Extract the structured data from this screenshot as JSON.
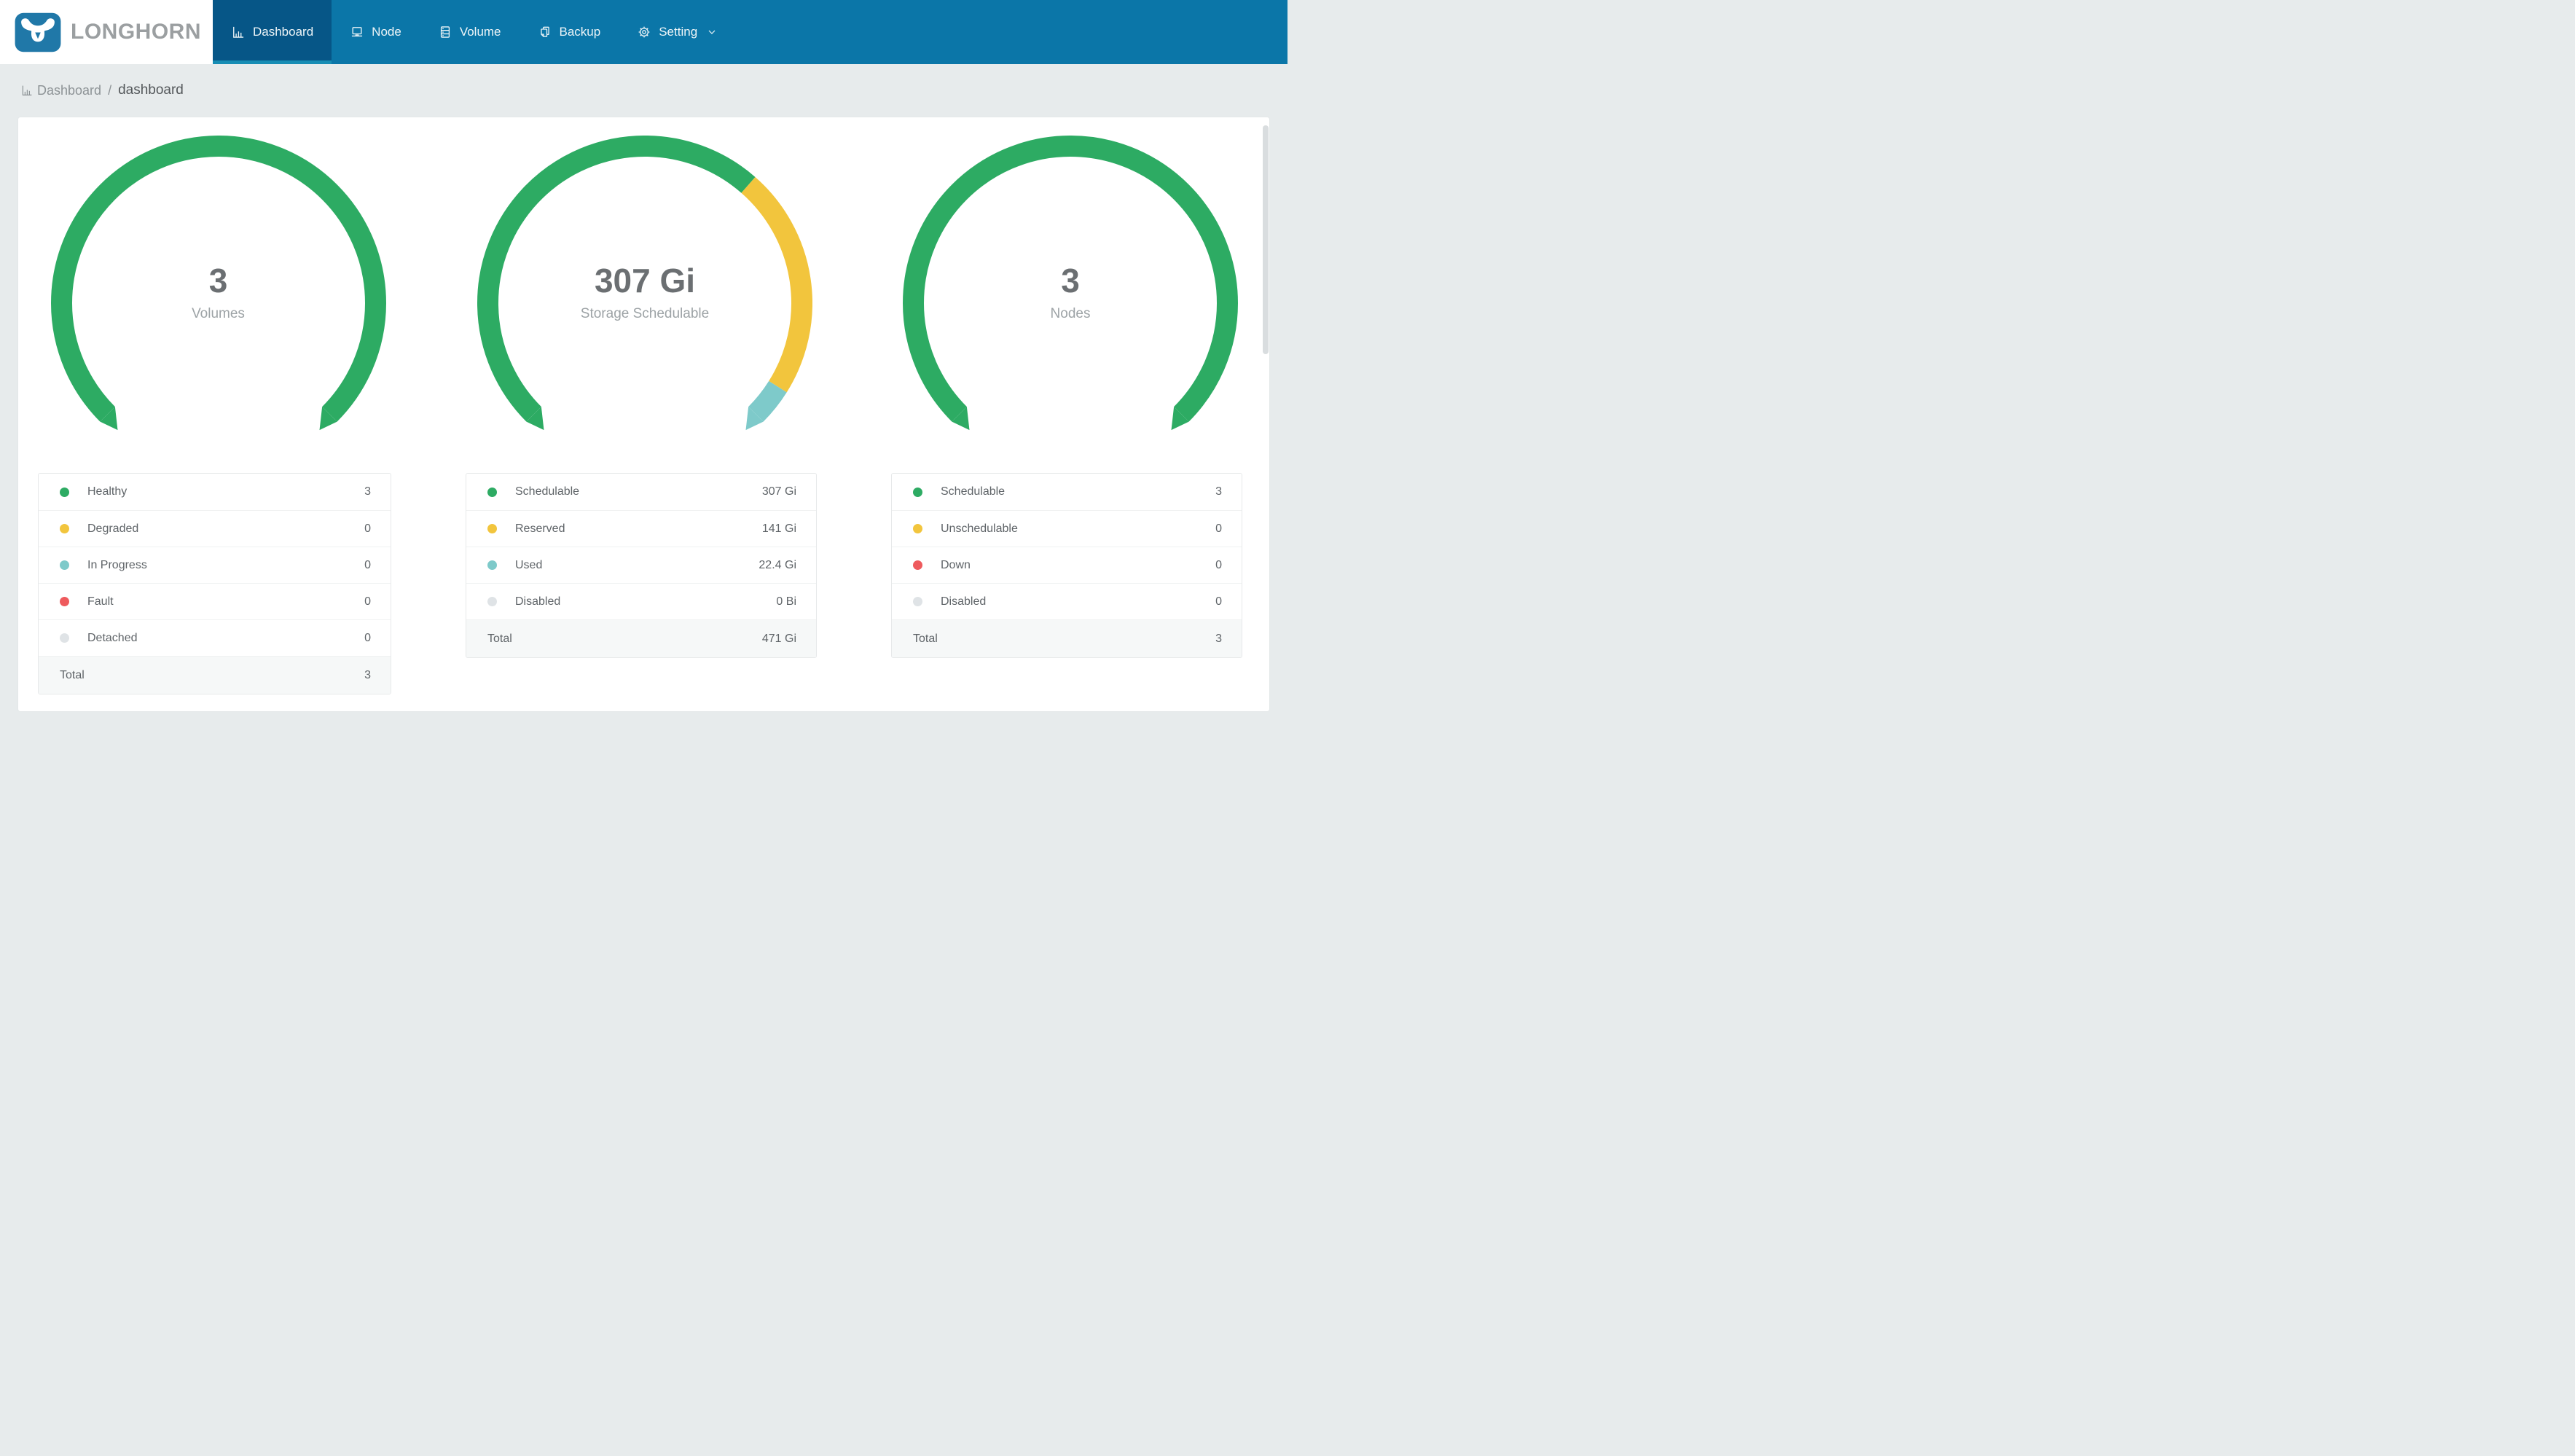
{
  "nav": {
    "brand": "LONGHORN",
    "items": [
      {
        "label": "Dashboard",
        "icon": "bar-chart-icon",
        "active": true
      },
      {
        "label": "Node",
        "icon": "laptop-icon",
        "active": false
      },
      {
        "label": "Volume",
        "icon": "storage-icon",
        "active": false
      },
      {
        "label": "Backup",
        "icon": "copy-icon",
        "active": false
      },
      {
        "label": "Setting",
        "icon": "gear-icon",
        "active": false,
        "has_dropdown": true
      }
    ]
  },
  "breadcrumb": {
    "icon": "bar-chart-icon",
    "section": "Dashboard",
    "separator": "/",
    "page": "dashboard"
  },
  "charts": [
    {
      "center_value": "3",
      "center_label": "Volumes",
      "legend": [
        {
          "label": "Healthy",
          "value": "3",
          "color": "#2dab63"
        },
        {
          "label": "Degraded",
          "value": "0",
          "color": "#f2c53d"
        },
        {
          "label": "In Progress",
          "value": "0",
          "color": "#7ecaca"
        },
        {
          "label": "Fault",
          "value": "0",
          "color": "#ee5a5d"
        },
        {
          "label": "Detached",
          "value": "0",
          "color": "#dfe3e6"
        }
      ],
      "total_label": "Total",
      "total_value": "3"
    },
    {
      "center_value": "307 Gi",
      "center_label": "Storage Schedulable",
      "legend": [
        {
          "label": "Schedulable",
          "value": "307 Gi",
          "color": "#2dab63"
        },
        {
          "label": "Reserved",
          "value": "141 Gi",
          "color": "#f2c53d"
        },
        {
          "label": "Used",
          "value": "22.4 Gi",
          "color": "#7ecaca"
        },
        {
          "label": "Disabled",
          "value": "0 Bi",
          "color": "#dfe3e6"
        }
      ],
      "total_label": "Total",
      "total_value": "471 Gi"
    },
    {
      "center_value": "3",
      "center_label": "Nodes",
      "legend": [
        {
          "label": "Schedulable",
          "value": "3",
          "color": "#2dab63"
        },
        {
          "label": "Unschedulable",
          "value": "0",
          "color": "#f2c53d"
        },
        {
          "label": "Down",
          "value": "0",
          "color": "#ee5a5d"
        },
        {
          "label": "Disabled",
          "value": "0",
          "color": "#dfe3e6"
        }
      ],
      "total_label": "Total",
      "total_value": "3"
    }
  ],
  "chart_data": [
    {
      "type": "gauge",
      "title": "Volumes",
      "center_value": "3",
      "arc_span_deg": 270,
      "segments": [
        {
          "name": "Healthy",
          "value": 3,
          "color": "#2dab63"
        },
        {
          "name": "Degraded",
          "value": 0,
          "color": "#f2c53d"
        },
        {
          "name": "In Progress",
          "value": 0,
          "color": "#7ecaca"
        },
        {
          "name": "Fault",
          "value": 0,
          "color": "#ee5a5d"
        },
        {
          "name": "Detached",
          "value": 0,
          "color": "#dfe3e6"
        }
      ],
      "total": 3
    },
    {
      "type": "gauge",
      "title": "Storage Schedulable",
      "center_value": "307 Gi",
      "arc_span_deg": 270,
      "segments": [
        {
          "name": "Schedulable",
          "value": 307,
          "color": "#2dab63"
        },
        {
          "name": "Reserved",
          "value": 141,
          "color": "#f2c53d"
        },
        {
          "name": "Used",
          "value": 22.4,
          "color": "#7ecaca"
        },
        {
          "name": "Disabled",
          "value": 0,
          "color": "#dfe3e6"
        }
      ],
      "total_label_value": "471 Gi"
    },
    {
      "type": "gauge",
      "title": "Nodes",
      "center_value": "3",
      "arc_span_deg": 270,
      "segments": [
        {
          "name": "Schedulable",
          "value": 3,
          "color": "#2dab63"
        },
        {
          "name": "Unschedulable",
          "value": 0,
          "color": "#f2c53d"
        },
        {
          "name": "Down",
          "value": 0,
          "color": "#ee5a5d"
        },
        {
          "name": "Disabled",
          "value": 0,
          "color": "#dfe3e6"
        }
      ],
      "total": 3
    }
  ],
  "colors": {
    "page_bg": "#e7ebec",
    "nav_bg": "#0b76a8",
    "active_tab": "#065687",
    "active_strip": "#178db4",
    "logo_blue": "#2078a8",
    "brand_text": "#9b9fa1",
    "card_bg": "#ffffff",
    "green": "#2dab63",
    "yellow": "#f2c53d",
    "teal": "#7ecaca",
    "red": "#ee5a5d",
    "gray": "#dfe3e6",
    "text": "#5f6468",
    "muted": "#9da3a6",
    "value_text": "#6b6f72",
    "total_row_bg": "#f6f8f8"
  }
}
